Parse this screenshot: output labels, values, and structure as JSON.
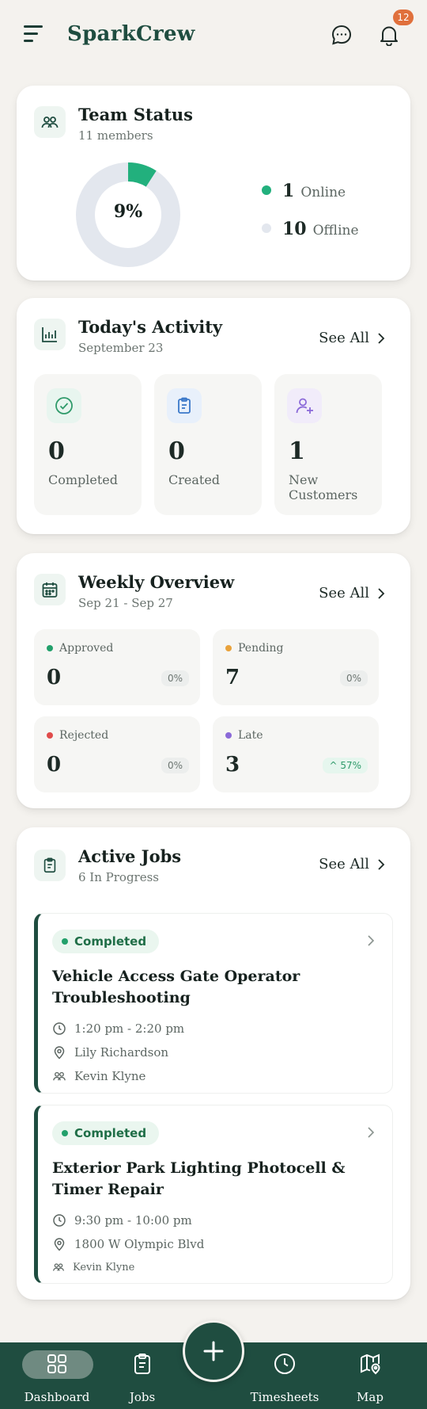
{
  "header": {
    "app_title": "SparkCrew",
    "notification_count": "12"
  },
  "team_status": {
    "title": "Team Status",
    "subtitle": "11 members",
    "online_percent_label": "9%",
    "online_fraction": 0.0909,
    "online_count": "1",
    "online_label": "Online",
    "offline_count": "10",
    "offline_label": "Offline",
    "colors": {
      "online": "#22b07d",
      "offline": "#e3e7ee"
    }
  },
  "activity": {
    "title": "Today's Activity",
    "subtitle": "September 23",
    "see_all": "See All",
    "tiles": [
      {
        "value": "0",
        "label": "Completed",
        "icon": "check-circle-icon"
      },
      {
        "value": "0",
        "label": "Created",
        "icon": "clipboard-icon"
      },
      {
        "value": "1",
        "label": "New Customers",
        "icon": "user-plus-icon"
      }
    ]
  },
  "weekly": {
    "title": "Weekly Overview",
    "subtitle": "Sep 21 - Sep 27",
    "see_all": "See All",
    "boxes": [
      {
        "label": "Approved",
        "value": "0",
        "pct": "0%",
        "color": "#22a06b"
      },
      {
        "label": "Pending",
        "value": "7",
        "pct": "0%",
        "color": "#e9a23b"
      },
      {
        "label": "Rejected",
        "value": "0",
        "pct": "0%",
        "color": "#e04b4b"
      },
      {
        "label": "Late",
        "value": "3",
        "pct": "^ 57%",
        "color": "#8b6ad8"
      }
    ]
  },
  "jobs": {
    "title": "Active Jobs",
    "subtitle": "6 In Progress",
    "see_all": "See All",
    "items": [
      {
        "status": "Completed",
        "title": "Vehicle Access Gate Operator Troubleshooting",
        "time": "1:20 pm - 2:20 pm",
        "location": "Lily Richardson",
        "crew": "Kevin Klyne"
      },
      {
        "status": "Completed",
        "title": "Exterior Park Lighting Photocell & Timer Repair",
        "time": "9:30 pm - 10:00 pm",
        "location": "1800 W Olympic Blvd",
        "crew": "Kevin Klyne"
      }
    ]
  },
  "nav": {
    "dashboard": "Dashboard",
    "jobs": "Jobs",
    "timesheets": "Timesheets",
    "map": "Map"
  }
}
